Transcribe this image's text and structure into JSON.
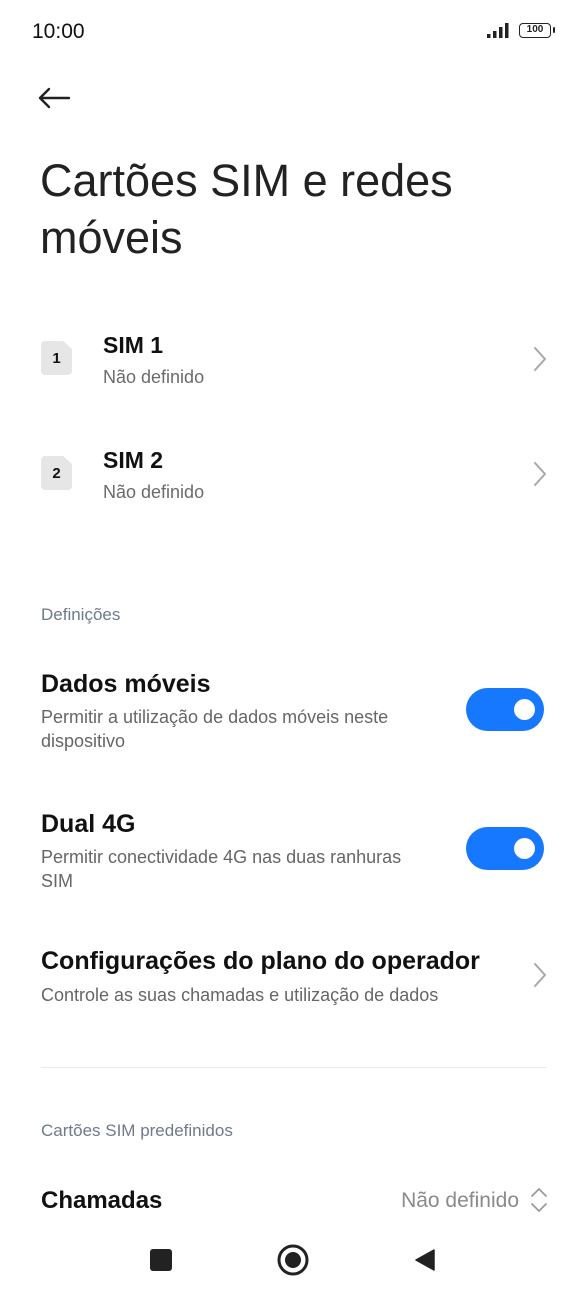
{
  "status_bar": {
    "time": "10:00",
    "battery_level": "100"
  },
  "header": {
    "title": "Cartões SIM e redes móveis"
  },
  "sims": [
    {
      "badge": "1",
      "title": "SIM 1",
      "subtitle": "Não definido"
    },
    {
      "badge": "2",
      "title": "SIM 2",
      "subtitle": "Não definido"
    }
  ],
  "settings_section": {
    "label": "Definições",
    "mobile_data": {
      "title": "Dados móveis",
      "description": "Permitir a utilização de dados móveis neste dispositivo",
      "enabled": true
    },
    "dual_4g": {
      "title": "Dual 4G",
      "description": "Permitir conectividade 4G nas duas ranhuras SIM",
      "enabled": true
    },
    "carrier_plan": {
      "title": "Configurações do plano do operador",
      "description": "Controle as suas chamadas e utilização de dados"
    }
  },
  "default_sims_section": {
    "label": "Cartões SIM predefinidos",
    "calls": {
      "title": "Chamadas",
      "value": "Não definido"
    }
  },
  "colors": {
    "accent": "#1677ff",
    "section_label": "#6f7a8a"
  },
  "icons": {
    "back": "arrow-left-icon",
    "chevron": "chevron-right-icon",
    "nav_recents": "square-icon",
    "nav_home": "circle-icon",
    "nav_back": "triangle-left-icon"
  }
}
